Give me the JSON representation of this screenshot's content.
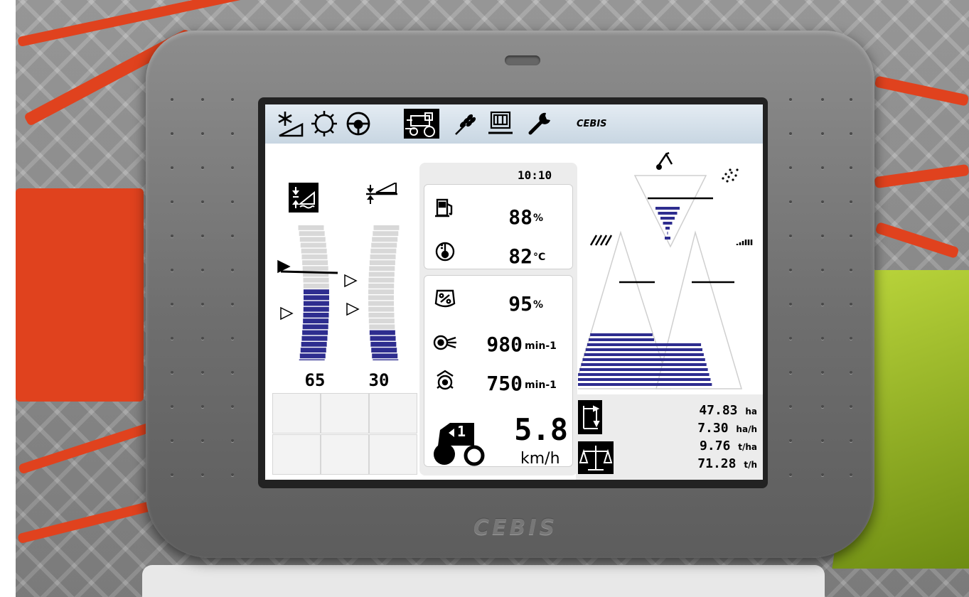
{
  "brand_text": "CEBIS",
  "device_logo": "CEBIS",
  "menu": {
    "items": [
      {
        "icon": "cleaning-fan-icon",
        "active": false
      },
      {
        "icon": "sprocket-icon",
        "active": false
      },
      {
        "icon": "steering-wheel-icon",
        "active": false
      },
      {
        "icon": "combine-harvester-icon",
        "active": true
      },
      {
        "icon": "grain-ear-icon",
        "active": false
      },
      {
        "icon": "monitor-display-icon",
        "active": false
      },
      {
        "icon": "wrench-icon",
        "active": false
      }
    ]
  },
  "left_panel": {
    "gauge_left": {
      "icon": "header-height-control-icon",
      "value": 65,
      "level": 0.54,
      "value_label": "65"
    },
    "gauge_right": {
      "icon": "header-tilt-control-icon",
      "value": 30,
      "level": 0.27,
      "value_label": "30"
    }
  },
  "center_panel": {
    "time": "10:10",
    "fuel": {
      "icon": "fuel-pump-icon",
      "value": "88",
      "unit": "%"
    },
    "coolant": {
      "icon": "thermometer-icon",
      "value": "82",
      "unit": "°C"
    },
    "engine_load": {
      "icon": "engine-load-icon",
      "value": "95",
      "unit": "%"
    },
    "engine_rpm": {
      "icon": "engine-fan-icon",
      "value": "980",
      "unit": "min-1"
    },
    "drum_rpm": {
      "icon": "threshing-drum-icon",
      "value": "750",
      "unit": "min-1"
    },
    "speed": {
      "icon": "tractor-gear-icon",
      "gear": "1",
      "value": "5.8",
      "unit": "km/h"
    }
  },
  "right_panel": {
    "icons": [
      "sieve-icon",
      "grain-spray-icon",
      "auger-icon",
      "return-rake-icon"
    ],
    "graphs": {
      "top_level": 0.6,
      "left_level": 0.35,
      "right_level": 0.3
    },
    "stats": [
      {
        "value": "47.83",
        "unit": "ha"
      },
      {
        "value": "7.30",
        "unit": "ha/h"
      },
      {
        "value": "9.76",
        "unit": "t/ha"
      },
      {
        "value": "71.28",
        "unit": "t/h"
      }
    ],
    "stat_icons": [
      "area-counter-icon",
      "yield-scale-icon"
    ]
  },
  "colors": {
    "accent": "#2e2d8f",
    "gauge_empty": "#d8d8d8",
    "menubar": "#d3dee8",
    "device": "#737373"
  }
}
